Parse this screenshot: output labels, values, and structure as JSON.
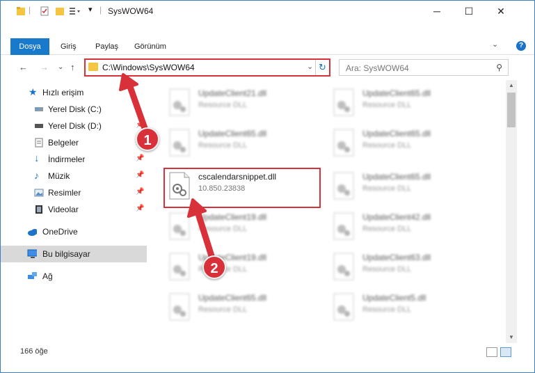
{
  "window": {
    "title": "SysWOW64"
  },
  "ribbon": {
    "tabs": [
      "Dosya",
      "Giriş",
      "Paylaş",
      "Görünüm"
    ]
  },
  "navigation": {
    "address": "C:\\Windows\\SysWOW64",
    "search_placeholder": "Ara: SysWOW64"
  },
  "sidebar": {
    "items": [
      {
        "label": "Hızlı erişim",
        "icon": "star-icon"
      },
      {
        "label": "Yerel Disk (C:)",
        "icon": "disk-icon"
      },
      {
        "label": "Yerel Disk (D:)",
        "icon": "disk-icon"
      },
      {
        "label": "Belgeler",
        "icon": "documents-icon"
      },
      {
        "label": "İndirmeler",
        "icon": "download-icon"
      },
      {
        "label": "Müzik",
        "icon": "music-icon"
      },
      {
        "label": "Resimler",
        "icon": "pictures-icon"
      },
      {
        "label": "Videolar",
        "icon": "video-icon"
      },
      {
        "label": "OneDrive",
        "icon": "cloud-icon"
      },
      {
        "label": "Bu bilgisayar",
        "icon": "computer-icon"
      },
      {
        "label": "Ağ",
        "icon": "network-icon"
      }
    ]
  },
  "files": {
    "col1": [
      {
        "name": "UpdateClient21.dll",
        "sub": "Resource DLL"
      },
      {
        "name": "UpdateClient65.dll",
        "sub": "Resource DLL"
      },
      {
        "name": "cscalendarsnippet.dll",
        "sub": "10.850.23838"
      },
      {
        "name": "UpdateClient19.dll",
        "sub": "Resource DLL"
      },
      {
        "name": "UpdateClient19.dll",
        "sub": "Resource DLL"
      },
      {
        "name": "UpdateClient65.dll",
        "sub": "Resource DLL"
      }
    ],
    "col2": [
      {
        "name": "UpdateClient65.dll",
        "sub": "Resource DLL"
      },
      {
        "name": "UpdateClient65.dll",
        "sub": "Resource DLL"
      },
      {
        "name": "UpdateClient65.dll",
        "sub": "Resource DLL"
      },
      {
        "name": "UpdateClient42.dll",
        "sub": "Resource DLL"
      },
      {
        "name": "UpdateClient63.dll",
        "sub": "Resource DLL"
      },
      {
        "name": "UpdateClient5.dll",
        "sub": "Resource DLL"
      }
    ]
  },
  "status": {
    "count": "166 öğe"
  },
  "annotations": {
    "badge1": "1",
    "badge2": "2",
    "accent_color": "#d9313a"
  }
}
